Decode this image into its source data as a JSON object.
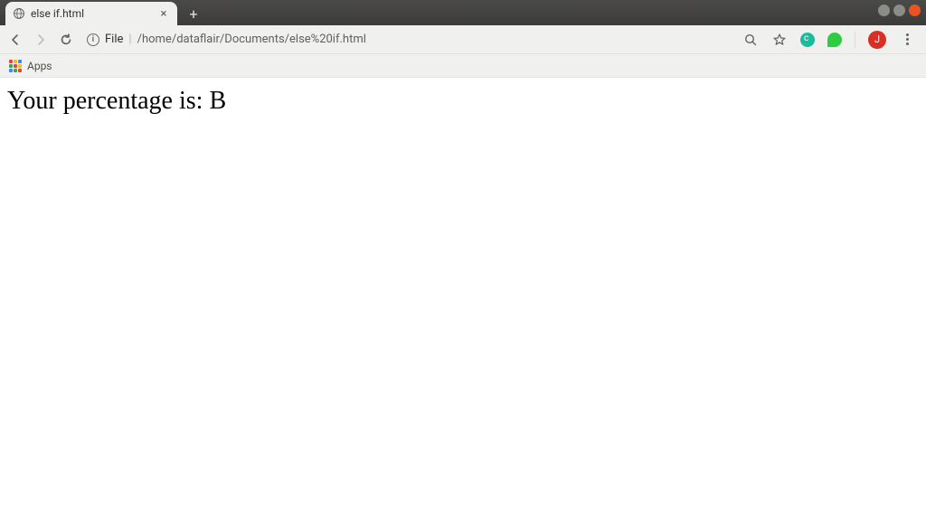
{
  "window": {
    "tab_title": "else if.html",
    "controls": {
      "minimize": true,
      "maximize": true,
      "close": true
    }
  },
  "toolbar": {
    "nav": {
      "back": "←",
      "forward": "→",
      "reload": "⟳"
    },
    "file_label": "File",
    "separator": "|",
    "url_path": "/home/dataflair/Documents/else%20if.html"
  },
  "right_icons": {
    "zoom": "zoom",
    "star": "star",
    "ext1": "grammarly",
    "ext2": "saver",
    "avatar_letter": "J"
  },
  "bookmarks": {
    "apps_label": "Apps"
  },
  "page": {
    "heading": "Your percentage is: B"
  }
}
